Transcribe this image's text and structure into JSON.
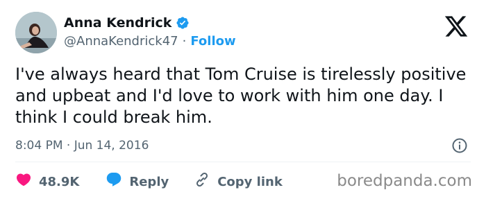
{
  "author": {
    "name": "Anna Kendrick",
    "handle": "@AnnaKendrick47",
    "separator": "·",
    "follow_label": "Follow",
    "verified": true
  },
  "tweet": {
    "text": "I've always heard that Tom Cruise is tirelessly positive and upbeat and I'd love to work with him one day. I think I could break him.",
    "timestamp": "8:04 PM · Jun 14, 2016"
  },
  "actions": {
    "like_count": "48.9K",
    "reply_label": "Reply",
    "copy_link_label": "Copy link"
  },
  "watermark": "boredpanda.com",
  "colors": {
    "accent": "#1d9bf0",
    "like": "#f91880",
    "secondary_text": "#536471"
  },
  "icons": [
    "verified-badge-icon",
    "x-logo-icon",
    "info-icon",
    "heart-icon",
    "reply-bubble-icon",
    "link-icon"
  ]
}
